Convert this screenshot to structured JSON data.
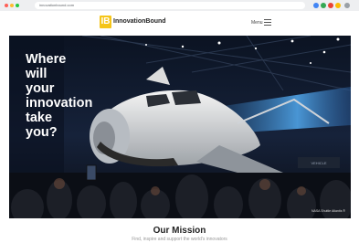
{
  "browser": {
    "url": "innovationbound.com",
    "dot_colors": [
      "#ff5f57",
      "#febc2e",
      "#28c840"
    ]
  },
  "header": {
    "logo_mark": "IB",
    "logo_text": "InnovationBound",
    "menu_label": "Menu"
  },
  "hero": {
    "title_lines": [
      "Where",
      "will",
      "your",
      "innovation",
      "take",
      "you?"
    ],
    "caption": "NASA Shuttle Atlantis ®"
  },
  "mission": {
    "title": "Our Mission",
    "subtitle": "Find, inspire and support the world's innovators"
  },
  "colors": {
    "brand_yellow": "#f5c518",
    "hero_dark": "#0d1626"
  }
}
